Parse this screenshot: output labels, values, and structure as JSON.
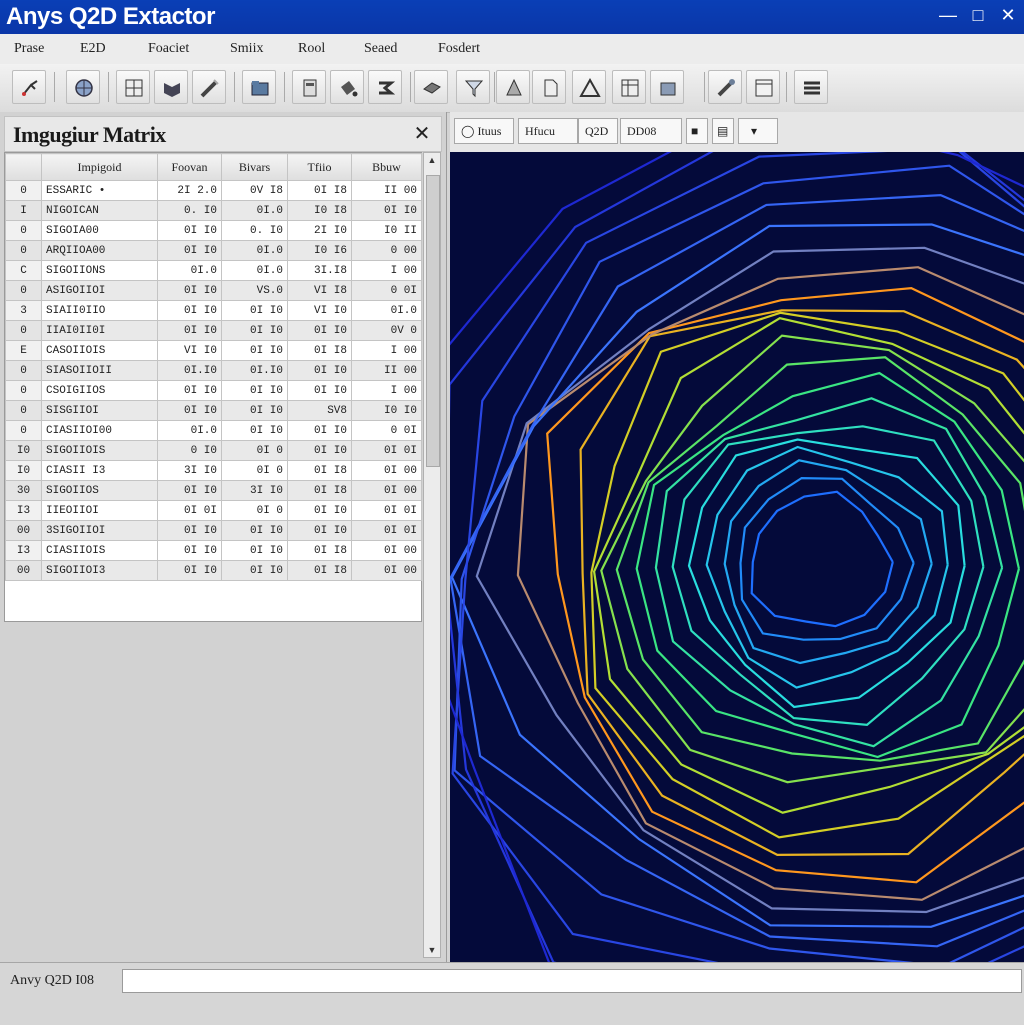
{
  "window": {
    "title": "Anys Q2D Extactor"
  },
  "menu": [
    "Prase",
    "E2D",
    "Foaciet",
    "Smiix",
    "Rool",
    "Seaed",
    "Fosdert"
  ],
  "panel": {
    "title": "Imgugiur Matrix",
    "columns": [
      "",
      "Impigoid",
      "Foovan",
      "Bivars",
      "Tfiio",
      "Bbuw"
    ],
    "rows": [
      [
        "0",
        "ESSARIC •",
        "2I 2.0",
        "0V I8",
        "0I I8",
        "II 00"
      ],
      [
        "I",
        "NIGOICAN",
        "0. I0",
        "0I.0",
        "I0 I8",
        "0I I0"
      ],
      [
        "0",
        "SIGOIA00",
        "0I I0",
        "0. I0",
        "2I I0",
        "I0 II"
      ],
      [
        "0",
        "ARQIIOA00",
        "0I I0",
        "0I.0",
        "I0 I6",
        "0 00"
      ],
      [
        "C",
        "SIGOIIONS",
        "0I.0",
        "0I.0",
        "3I.I8",
        "I 00"
      ],
      [
        "0",
        "ASIGOIIOI",
        "0I I0",
        "VS.0",
        "VI I8",
        "0 0I"
      ],
      [
        "3",
        "SIAII0IIO",
        "0I I0",
        "0I I0",
        "VI I0",
        "0I.0"
      ],
      [
        "0",
        "IIAI0II0I",
        "0I I0",
        "0I I0",
        "0I I0",
        "0V 0"
      ],
      [
        "E",
        "CASOIIOIS",
        "VI I0",
        "0I I0",
        "0I I8",
        "I 00"
      ],
      [
        "0",
        "SIASOIIOII",
        "0I.I0",
        "0I.I0",
        "0I I0",
        "II 00"
      ],
      [
        "0",
        "CSOIGIIOS",
        "0I I0",
        "0I I0",
        "0I I0",
        "I 00"
      ],
      [
        "0",
        "SISGIIOI",
        "0I I0",
        "0I I0",
        "SV8",
        "I0 I0"
      ],
      [
        "0",
        "CIASIIOI00",
        "0I.0",
        "0I I0",
        "0I I0",
        "0 0I"
      ],
      [
        "I0",
        "SIGOIIOIS",
        "0 I0",
        "0I 0",
        "0I I0",
        "0I 0I"
      ],
      [
        "I0",
        "CIASII I3",
        "3I I0",
        "0I 0",
        "0I I8",
        "0I 00"
      ],
      [
        "30",
        "SIGOIIOS",
        "0I I0",
        "3I I0",
        "0I I8",
        "0I 00"
      ],
      [
        "I3",
        "IIEOIIOI",
        "0I 0I",
        "0I 0",
        "0I I0",
        "0I 0I"
      ],
      [
        "00",
        "3SIGOIIOI",
        "0I I0",
        "0I I0",
        "0I I0",
        "0I 0I"
      ],
      [
        "I3",
        "CIASIIOIS",
        "0I I0",
        "0I I0",
        "0I I8",
        "0I 00"
      ],
      [
        "00",
        "SIGOIIOI3",
        "0I I0",
        "0I I0",
        "0I I8",
        "0I 00"
      ]
    ]
  },
  "view_toolbar": {
    "field1": "Ituus",
    "field2": "Hfucu",
    "field3": "Q2D",
    "field4": "DD08"
  },
  "status": {
    "label": "Anvy Q2D I08"
  },
  "colors": {
    "viewport_bg": "#040a3a",
    "titlebar": "#0a3fb6"
  },
  "icons": [
    "cursor-icon",
    "globe-icon",
    "grid-icon",
    "flag-icon",
    "wand-icon",
    "folder-icon",
    "page-icon",
    "bucket-icon",
    "arrow-icon",
    "eraser-icon",
    "funnel-icon",
    "cone-icon",
    "doc-icon",
    "triangle-icon",
    "table-icon",
    "box-icon",
    "brush-icon",
    "window-icon",
    "list-icon"
  ]
}
